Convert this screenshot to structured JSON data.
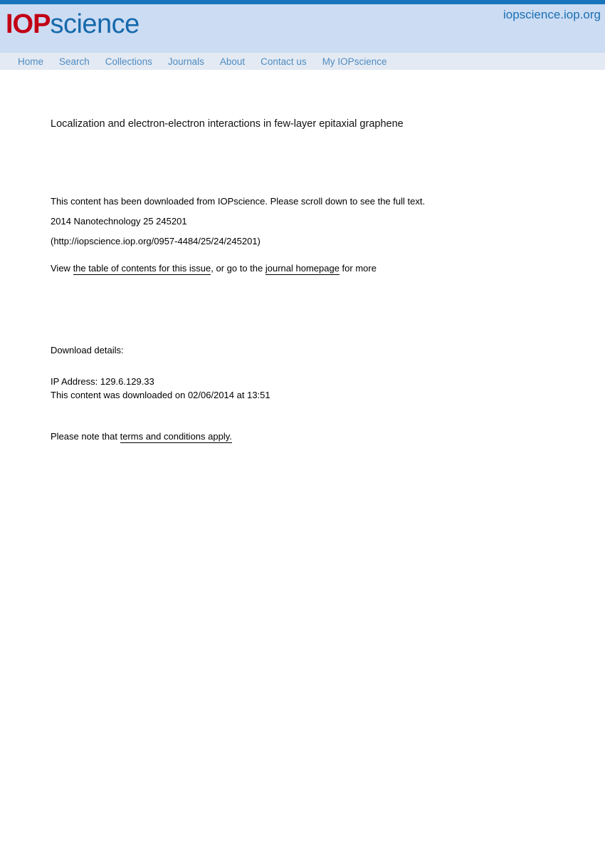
{
  "site": {
    "logo_primary": "IOP",
    "logo_secondary": "science",
    "url_label": "iopscience.iop.org",
    "brand_red": "#c20016",
    "brand_blue": "#1669ab",
    "topbar_color": "#1874bb",
    "header_bg": "#cbdcf3",
    "nav_bg": "#e4eaf3",
    "nav_link_color": "#4e8cc2"
  },
  "nav": {
    "items": [
      {
        "label": "Home"
      },
      {
        "label": "Search"
      },
      {
        "label": "Collections"
      },
      {
        "label": "Journals"
      },
      {
        "label": "About"
      },
      {
        "label": "Contact us"
      },
      {
        "label": "My IOPscience"
      }
    ]
  },
  "article": {
    "title": "Localization and electron-electron interactions in few-layer epitaxial graphene",
    "download_notice": "This content has been downloaded from IOPscience. Please scroll down to see the full text.",
    "citation": "2014 Nanotechnology 25 245201",
    "doi_url": "(http://iopscience.iop.org/0957-4484/25/24/245201)"
  },
  "view_line": {
    "prefix": "View ",
    "toc_link": "the table of contents for this issue",
    "middle": ", or go to the ",
    "journal_link": "journal homepage",
    "suffix": " for more"
  },
  "download_details": {
    "heading": "Download details:",
    "ip_line": "IP Address: 129.6.129.33",
    "time_line": "This content was downloaded on 02/06/2014 at 13:51"
  },
  "terms": {
    "prefix": "Please note that ",
    "link": "terms and conditions apply.",
    "suffix": ""
  }
}
